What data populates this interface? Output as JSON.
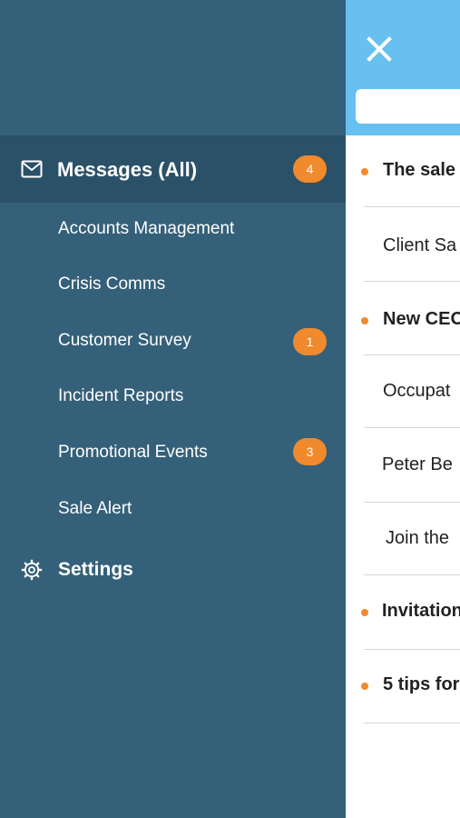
{
  "drawer": {
    "messages_all": {
      "label": "Messages (All)",
      "badge": "4",
      "icon": "envelope-icon"
    },
    "folders": [
      {
        "label": "Accounts Management",
        "badge": ""
      },
      {
        "label": "Crisis Comms",
        "badge": ""
      },
      {
        "label": "Customer Survey",
        "badge": "1"
      },
      {
        "label": "Incident Reports",
        "badge": ""
      },
      {
        "label": "Promotional Events",
        "badge": "3"
      },
      {
        "label": "Sale Alert",
        "badge": ""
      }
    ],
    "settings": {
      "label": "Settings",
      "icon": "gear-icon"
    }
  },
  "main": {
    "close_icon": "close-icon",
    "messages": [
      {
        "title": "The sale",
        "unread": true
      },
      {
        "title": "Client Sa",
        "unread": false
      },
      {
        "title": "New CEO",
        "unread": true
      },
      {
        "title": "Occupat",
        "unread": false
      },
      {
        "title": "Peter Be",
        "unread": false
      },
      {
        "title": "Join the",
        "unread": false
      },
      {
        "title": "Invitation",
        "unread": true
      },
      {
        "title": "5 tips for",
        "unread": true
      }
    ]
  },
  "colors": {
    "drawer_bg": "#356079",
    "drawer_active_bg": "#2b5168",
    "header_bg": "#67c0ef",
    "badge": "#f08a2c",
    "unread_dot": "#f08a2c"
  }
}
